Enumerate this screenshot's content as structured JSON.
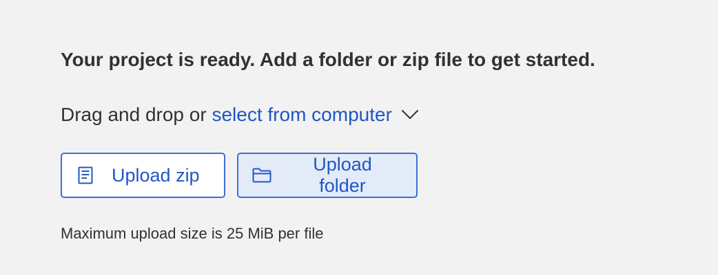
{
  "headline": "Your project is ready. Add a folder or zip file to get started.",
  "drag_prompt": {
    "prefix": "Drag and drop or",
    "link": "select from computer",
    "chevron_icon": "chevron-down-icon"
  },
  "buttons": {
    "zip": {
      "label": "Upload zip",
      "icon": "document-icon"
    },
    "folder": {
      "label": "Upload folder",
      "icon": "folder-icon"
    }
  },
  "footnote": "Maximum upload size is 25 MiB per file",
  "colors": {
    "background": "#f2f2f2",
    "text": "#313131",
    "accent": "#1f56c4",
    "button_border": "#3a6ed8",
    "active_button_bg": "#e3ebf8"
  }
}
